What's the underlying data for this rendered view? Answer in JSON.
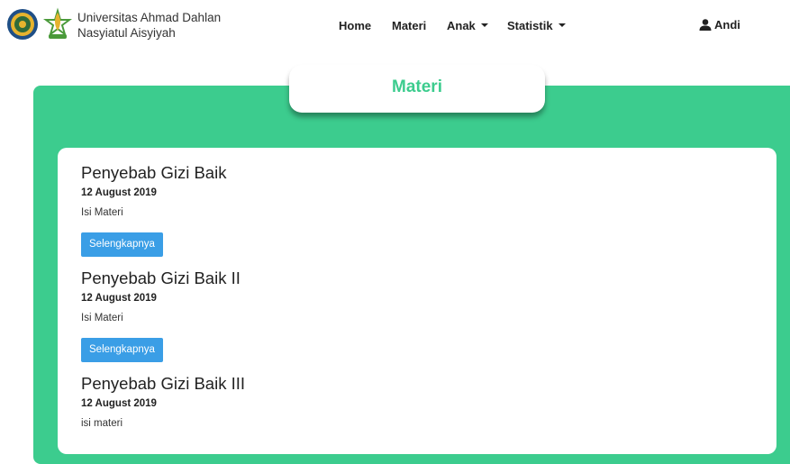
{
  "header": {
    "brand_line1": "Universitas Ahmad Dahlan",
    "brand_line2": "Nasyiatul Aisyiyah",
    "nav": [
      {
        "label": "Home"
      },
      {
        "label": "Materi"
      },
      {
        "label": "Anak"
      },
      {
        "label": "Statistik"
      }
    ],
    "user_name": "Andi"
  },
  "page": {
    "title": "Materi"
  },
  "articles": [
    {
      "title": "Penyebab Gizi Baik",
      "date": "12 August 2019",
      "excerpt": "Isi Materi",
      "button": "Selengkapnya"
    },
    {
      "title": "Penyebab Gizi Baik II",
      "date": "12 August 2019",
      "excerpt": "Isi Materi",
      "button": "Selengkapnya"
    },
    {
      "title": "Penyebab Gizi Baik III",
      "date": "12 August 2019",
      "excerpt": "isi materi"
    }
  ],
  "colors": {
    "accent_green": "#3ccc8e",
    "button_blue": "#3a9ee6"
  },
  "icons": {
    "user": "user-icon",
    "dropdown": "caret-down-icon"
  }
}
